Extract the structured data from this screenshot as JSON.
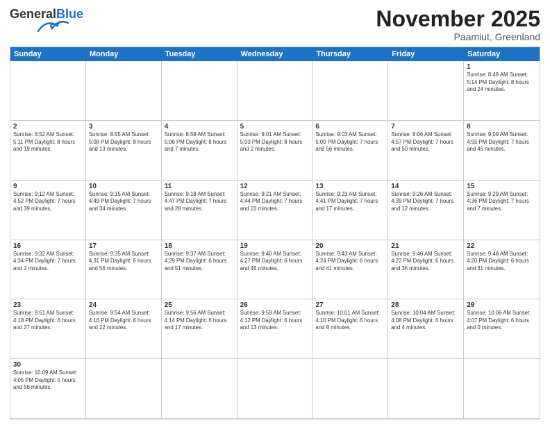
{
  "header": {
    "logo_general": "General",
    "logo_blue": "Blue",
    "month": "November 2025",
    "location": "Paamiut, Greenland"
  },
  "days": [
    "Sunday",
    "Monday",
    "Tuesday",
    "Wednesday",
    "Thursday",
    "Friday",
    "Saturday"
  ],
  "cells": [
    {
      "num": "",
      "info": ""
    },
    {
      "num": "",
      "info": ""
    },
    {
      "num": "",
      "info": ""
    },
    {
      "num": "",
      "info": ""
    },
    {
      "num": "",
      "info": ""
    },
    {
      "num": "",
      "info": ""
    },
    {
      "num": "1",
      "info": "Sunrise: 8:49 AM\nSunset: 5:14 PM\nDaylight: 8 hours\nand 24 minutes."
    },
    {
      "num": "2",
      "info": "Sunrise: 8:52 AM\nSunset: 5:11 PM\nDaylight: 8 hours\nand 19 minutes."
    },
    {
      "num": "3",
      "info": "Sunrise: 8:55 AM\nSunset: 5:08 PM\nDaylight: 8 hours\nand 13 minutes."
    },
    {
      "num": "4",
      "info": "Sunrise: 8:58 AM\nSunset: 5:06 PM\nDaylight: 8 hours\nand 7 minutes."
    },
    {
      "num": "5",
      "info": "Sunrise: 9:01 AM\nSunset: 5:03 PM\nDaylight: 8 hours\nand 2 minutes."
    },
    {
      "num": "6",
      "info": "Sunrise: 9:03 AM\nSunset: 5:00 PM\nDaylight: 7 hours\nand 56 minutes."
    },
    {
      "num": "7",
      "info": "Sunrise: 9:06 AM\nSunset: 4:57 PM\nDaylight: 7 hours\nand 50 minutes."
    },
    {
      "num": "8",
      "info": "Sunrise: 9:09 AM\nSunset: 4:55 PM\nDaylight: 7 hours\nand 45 minutes."
    },
    {
      "num": "9",
      "info": "Sunrise: 9:12 AM\nSunset: 4:52 PM\nDaylight: 7 hours\nand 39 minutes."
    },
    {
      "num": "10",
      "info": "Sunrise: 9:15 AM\nSunset: 4:49 PM\nDaylight: 7 hours\nand 34 minutes."
    },
    {
      "num": "11",
      "info": "Sunrise: 9:18 AM\nSunset: 4:47 PM\nDaylight: 7 hours\nand 28 minutes."
    },
    {
      "num": "12",
      "info": "Sunrise: 9:21 AM\nSunset: 4:44 PM\nDaylight: 7 hours\nand 23 minutes."
    },
    {
      "num": "13",
      "info": "Sunrise: 9:23 AM\nSunset: 4:41 PM\nDaylight: 7 hours\nand 17 minutes."
    },
    {
      "num": "14",
      "info": "Sunrise: 9:26 AM\nSunset: 4:39 PM\nDaylight: 7 hours\nand 12 minutes."
    },
    {
      "num": "15",
      "info": "Sunrise: 9:29 AM\nSunset: 4:36 PM\nDaylight: 7 hours\nand 7 minutes."
    },
    {
      "num": "16",
      "info": "Sunrise: 9:32 AM\nSunset: 4:34 PM\nDaylight: 7 hours\nand 2 minutes."
    },
    {
      "num": "17",
      "info": "Sunrise: 9:35 AM\nSunset: 4:31 PM\nDaylight: 6 hours\nand 56 minutes."
    },
    {
      "num": "18",
      "info": "Sunrise: 9:37 AM\nSunset: 4:29 PM\nDaylight: 6 hours\nand 51 minutes."
    },
    {
      "num": "19",
      "info": "Sunrise: 9:40 AM\nSunset: 4:27 PM\nDaylight: 6 hours\nand 46 minutes."
    },
    {
      "num": "20",
      "info": "Sunrise: 9:43 AM\nSunset: 4:24 PM\nDaylight: 6 hours\nand 41 minutes."
    },
    {
      "num": "21",
      "info": "Sunrise: 9:46 AM\nSunset: 4:22 PM\nDaylight: 6 hours\nand 36 minutes."
    },
    {
      "num": "22",
      "info": "Sunrise: 9:48 AM\nSunset: 4:20 PM\nDaylight: 6 hours\nand 31 minutes."
    },
    {
      "num": "23",
      "info": "Sunrise: 9:51 AM\nSunset: 4:18 PM\nDaylight: 6 hours\nand 27 minutes."
    },
    {
      "num": "24",
      "info": "Sunrise: 9:54 AM\nSunset: 4:16 PM\nDaylight: 6 hours\nand 22 minutes."
    },
    {
      "num": "25",
      "info": "Sunrise: 9:56 AM\nSunset: 4:14 PM\nDaylight: 6 hours\nand 17 minutes."
    },
    {
      "num": "26",
      "info": "Sunrise: 9:59 AM\nSunset: 4:12 PM\nDaylight: 6 hours\nand 13 minutes."
    },
    {
      "num": "27",
      "info": "Sunrise: 10:01 AM\nSunset: 4:10 PM\nDaylight: 6 hours\nand 8 minutes."
    },
    {
      "num": "28",
      "info": "Sunrise: 10:04 AM\nSunset: 4:08 PM\nDaylight: 6 hours\nand 4 minutes."
    },
    {
      "num": "29",
      "info": "Sunrise: 10:06 AM\nSunset: 4:07 PM\nDaylight: 6 hours\nand 0 minutes."
    },
    {
      "num": "30",
      "info": "Sunrise: 10:09 AM\nSunset: 4:05 PM\nDaylight: 5 hours\nand 56 minutes."
    },
    {
      "num": "",
      "info": ""
    },
    {
      "num": "",
      "info": ""
    },
    {
      "num": "",
      "info": ""
    },
    {
      "num": "",
      "info": ""
    },
    {
      "num": "",
      "info": ""
    },
    {
      "num": "",
      "info": ""
    }
  ]
}
